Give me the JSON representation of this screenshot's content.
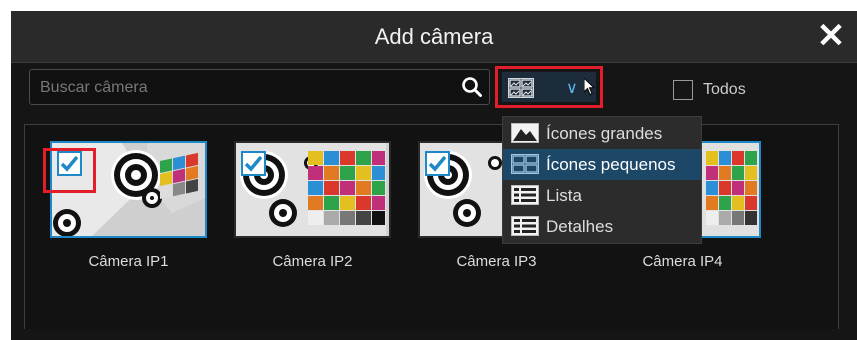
{
  "dialog": {
    "title": "Add câmera",
    "close_glyph": "✕"
  },
  "search": {
    "placeholder": "Buscar câmera",
    "value": "",
    "icon": "search-icon"
  },
  "view_selector": {
    "current": "Ícones pequenos",
    "icon": "small-icons-icon",
    "chevron": "∨"
  },
  "select_all": {
    "label": "Todos",
    "checked": false
  },
  "cameras": [
    {
      "label": "Câmera IP1",
      "checked": true
    },
    {
      "label": "Câmera IP2",
      "checked": true
    },
    {
      "label": "Câmera IP3",
      "checked": true
    },
    {
      "label": "Câmera IP4",
      "checked": false
    }
  ],
  "view_menu": {
    "items": [
      {
        "label": "Ícones grandes",
        "icon": "large-icons-icon",
        "highlighted": false
      },
      {
        "label": "Ícones pequenos",
        "icon": "small-icons-icon",
        "highlighted": true
      },
      {
        "label": "Lista",
        "icon": "list-icon",
        "highlighted": false
      },
      {
        "label": "Detalhes",
        "icon": "details-icon",
        "highlighted": false
      }
    ]
  },
  "colors": {
    "accent": "#1e88c8",
    "highlight": "#e21e2a",
    "menu_highlight": "#1c4766"
  }
}
